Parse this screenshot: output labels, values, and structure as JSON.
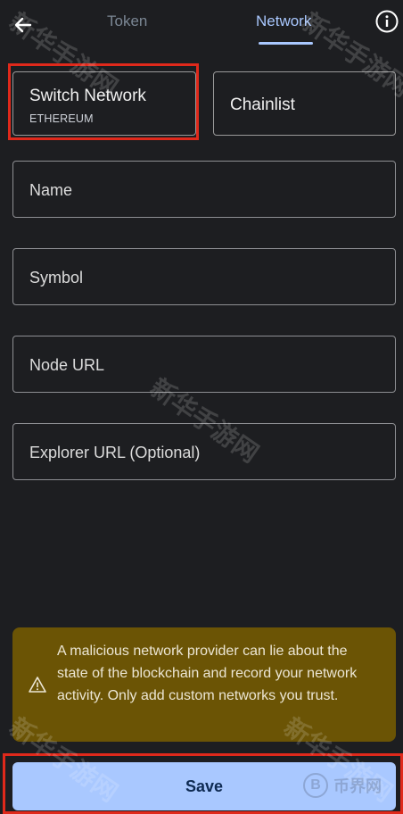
{
  "header": {
    "back_icon": "arrow-left-icon",
    "tabs": [
      {
        "label": "Token",
        "active": false
      },
      {
        "label": "Network",
        "active": true
      }
    ],
    "info_icon": "info-icon",
    "accent": "#a9c8ff"
  },
  "network_switch": {
    "title": "Switch Network",
    "current": "ETHEREUM"
  },
  "chainlist_label": "Chainlist",
  "fields": {
    "name": "Name",
    "symbol": "Symbol",
    "node_url": "Node URL",
    "explorer_url": "Explorer URL (Optional)"
  },
  "warning": {
    "icon": "warning-triangle-icon",
    "text": "A malicious network provider can lie about the state of the blockchain and record your network activity. Only add custom networks you trust.",
    "background": "#6b5405"
  },
  "save_label": "Save",
  "highlight_color": "#e0291b",
  "watermarks": {
    "site_text": "新华手游网",
    "logo_glyph": "B",
    "logo_text": "币界网"
  }
}
